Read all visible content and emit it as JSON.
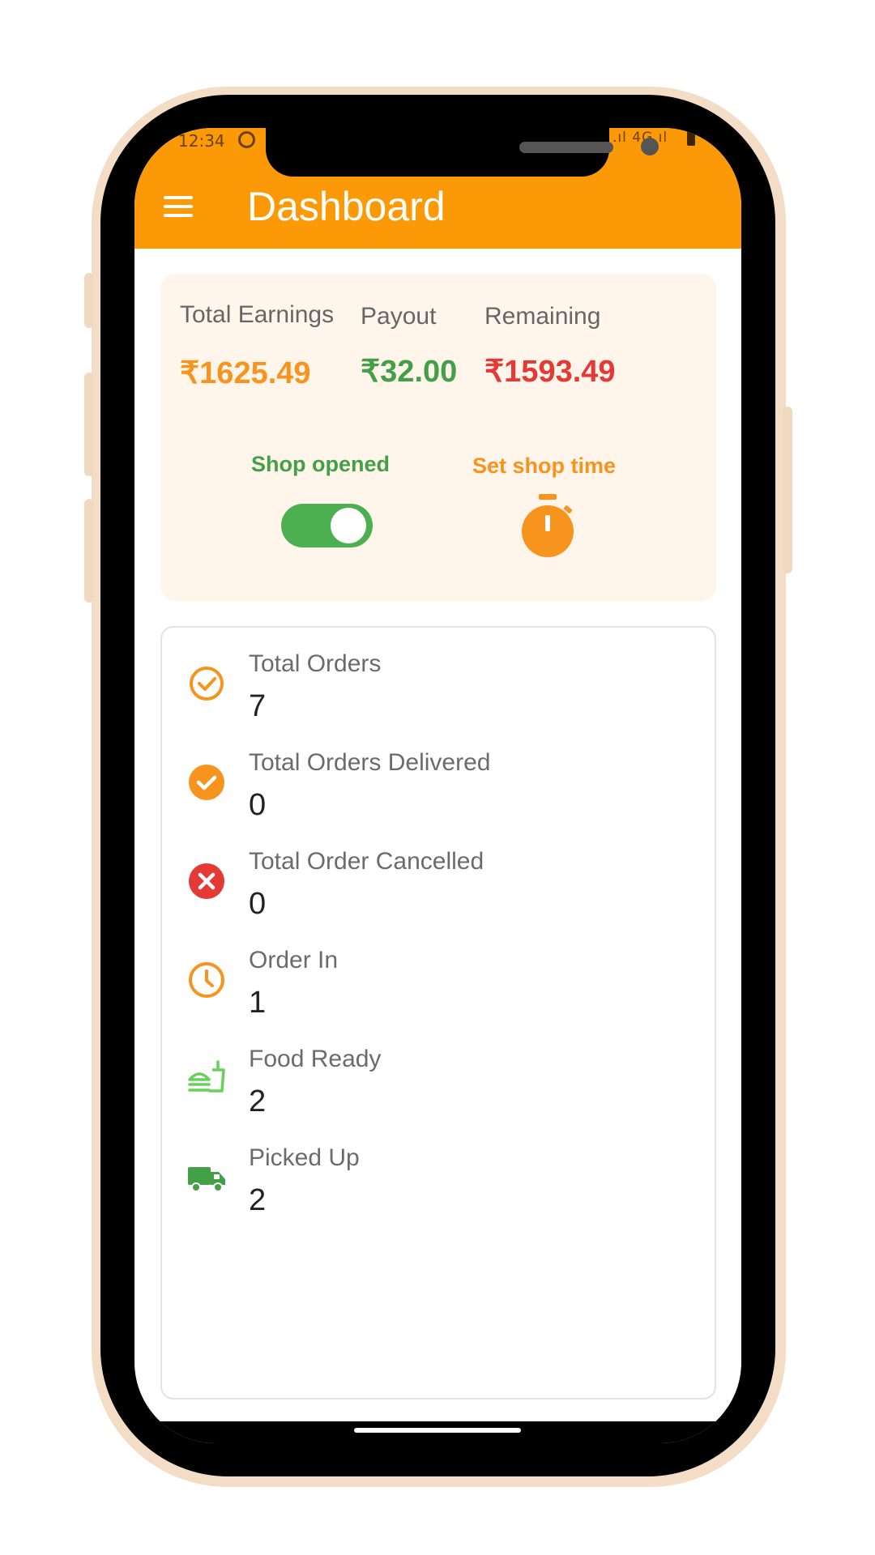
{
  "status_bar": {
    "time": "12:34",
    "right_text": ".ıl 4G ıl"
  },
  "app_bar": {
    "title": "Dashboard",
    "menu_icon": "hamburger-menu-icon",
    "color": "#fb9a06"
  },
  "earnings": {
    "total_earnings": {
      "label": "Total Earnings",
      "value": "₹1625.49",
      "color": "#f7941d"
    },
    "payout": {
      "label": "Payout",
      "value": "₹32.00",
      "color": "#43a047"
    },
    "remaining": {
      "label": "Remaining",
      "value": "₹1593.49",
      "color": "#e53935"
    }
  },
  "shop": {
    "status_label": "Shop opened",
    "toggle_on": true,
    "set_time_label": "Set shop time",
    "timer_icon": "stopwatch-icon"
  },
  "stats": [
    {
      "label": "Total Orders",
      "value": "7",
      "icon": "check-circle-outline-icon",
      "color": "#f7941d"
    },
    {
      "label": "Total Orders Delivered",
      "value": "0",
      "icon": "check-circle-filled-icon",
      "color": "#f7941d"
    },
    {
      "label": "Total Order Cancelled",
      "value": "0",
      "icon": "cancel-circle-icon",
      "color": "#e53935"
    },
    {
      "label": "Order In",
      "value": "1",
      "icon": "clock-icon",
      "color": "#f7941d"
    },
    {
      "label": "Food Ready",
      "value": "2",
      "icon": "food-ready-icon",
      "color": "#69d05a"
    },
    {
      "label": "Picked Up",
      "value": "2",
      "icon": "delivery-truck-icon",
      "color": "#43a047"
    }
  ]
}
